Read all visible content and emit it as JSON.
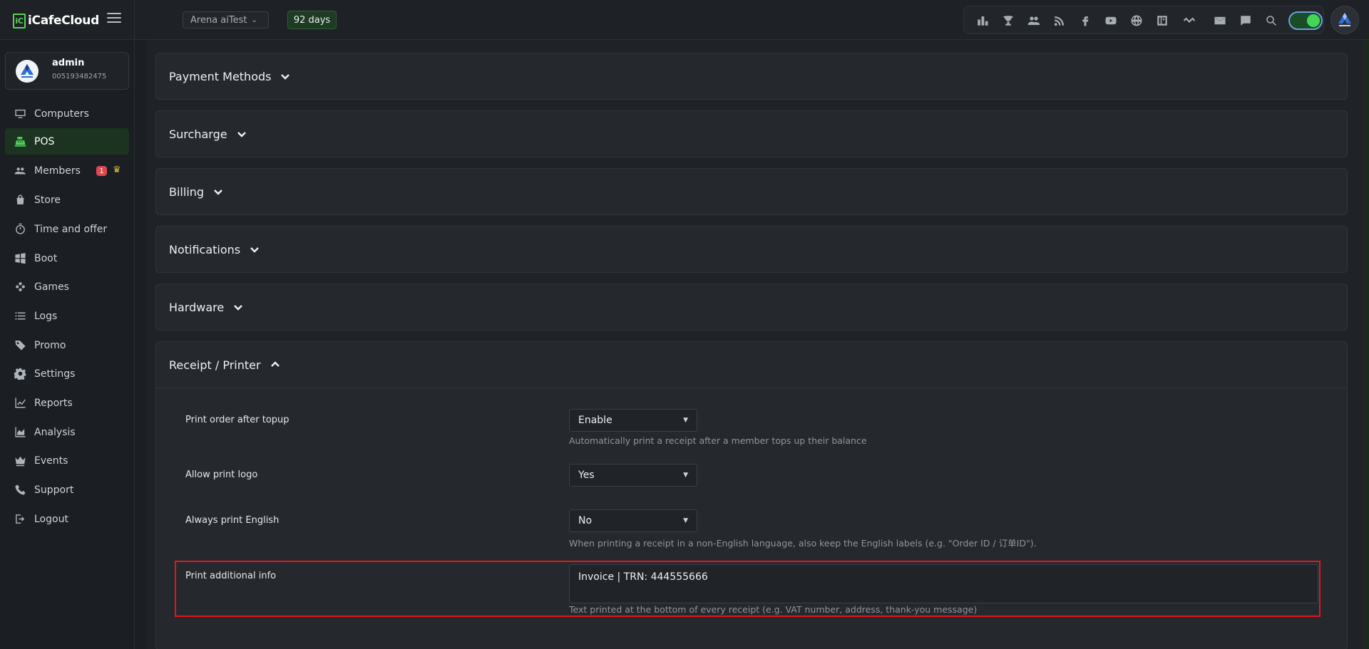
{
  "app": {
    "name": "iCafeCloud",
    "logo_mark": "iC"
  },
  "topbar": {
    "arena": "Arena aiTest",
    "days": "92 days",
    "tools": [
      "leaderboard-icon",
      "trophy-icon",
      "group-icon",
      "rss-icon",
      "facebook-icon",
      "youtube-icon",
      "globe-icon",
      "app-icon",
      "handshake-icon",
      "mail-icon",
      "chat-icon",
      "search-icon"
    ],
    "toggle_on": true
  },
  "user": {
    "name": "admin",
    "id": "005193482475"
  },
  "nav": [
    {
      "label": "Computers",
      "icon": "monitor-icon"
    },
    {
      "label": "POS",
      "icon": "cashier-icon",
      "active": true
    },
    {
      "label": "Members",
      "icon": "members-icon",
      "badge": "1"
    },
    {
      "label": "Store",
      "icon": "bag-icon"
    },
    {
      "label": "Time and offer",
      "icon": "timer-icon"
    },
    {
      "label": "Boot",
      "icon": "windows-icon"
    },
    {
      "label": "Games",
      "icon": "gamepad-icon"
    },
    {
      "label": "Logs",
      "icon": "list-icon"
    },
    {
      "label": "Promo",
      "icon": "tag-icon"
    },
    {
      "label": "Settings",
      "icon": "gear-icon"
    },
    {
      "label": "Reports",
      "icon": "line-chart-icon"
    },
    {
      "label": "Analysis",
      "icon": "area-chart-icon"
    },
    {
      "label": "Events",
      "icon": "crown-icon"
    },
    {
      "label": "Support",
      "icon": "phone-icon"
    },
    {
      "label": "Logout",
      "icon": "logout-icon"
    }
  ],
  "sections": [
    {
      "title": "Payment Methods",
      "expanded": false
    },
    {
      "title": "Surcharge",
      "expanded": false
    },
    {
      "title": "Billing",
      "expanded": false
    },
    {
      "title": "Notifications",
      "expanded": false
    },
    {
      "title": "Hardware",
      "expanded": false
    },
    {
      "title": "Receipt / Printer",
      "expanded": true
    }
  ],
  "receipt": {
    "print_order": {
      "label": "Print order after topup",
      "value": "Enable",
      "help": "Automatically print a receipt after a member tops up their balance"
    },
    "print_logo": {
      "label": "Allow print logo",
      "value": "Yes"
    },
    "print_english": {
      "label": "Always print English",
      "value": "No",
      "help": "When printing a receipt in a non-English language, also keep the English labels (e.g. \"Order ID / 订单ID\")."
    },
    "additional_info": {
      "label": "Print additional info",
      "value": "Invoice  |  TRN: 444555666",
      "help": "Text printed at the bottom of every receipt (e.g. VAT number, address, thank-you message)"
    }
  },
  "colors": {
    "accent": "#4cd05a",
    "highlight": "#e3171b",
    "badge": "#e0484f"
  }
}
